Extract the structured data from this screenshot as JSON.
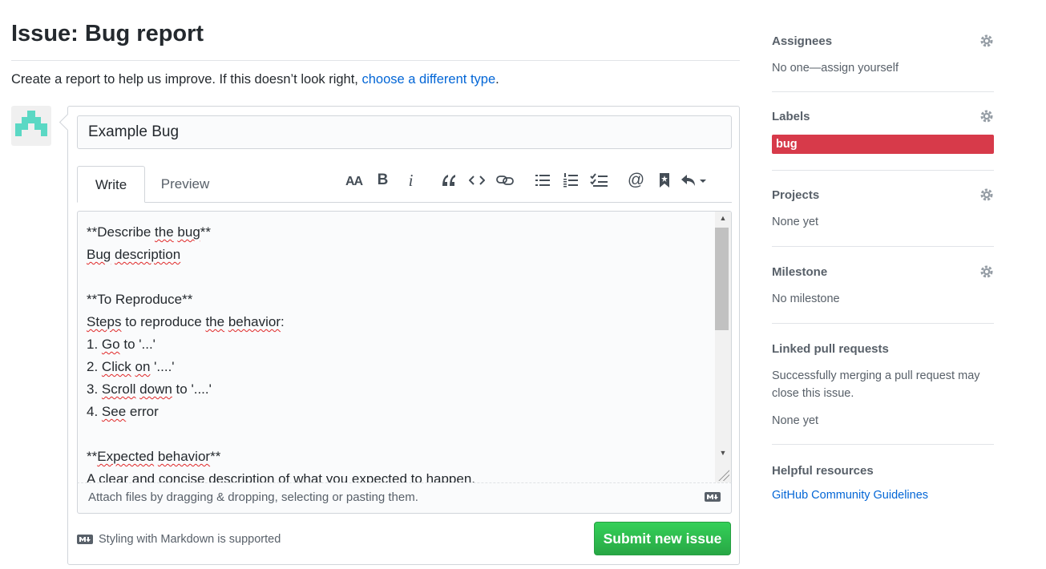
{
  "page": {
    "title": "Issue: Bug report",
    "intro_text": "Create a report to help us improve. If this doesn’t look right,",
    "intro_link": "choose a different type",
    "intro_end": "."
  },
  "form": {
    "title_value": "Example Bug",
    "tabs": {
      "write": "Write",
      "preview": "Preview"
    },
    "toolbar": {
      "heading": "AA",
      "bold": "B",
      "italic": "i",
      "quote": "❝",
      "code": "<>",
      "mention": "@"
    },
    "body_lines": [
      "**Describe the bug**",
      "Bug description",
      "",
      "**To Reproduce**",
      "Steps to reproduce the behavior:",
      "1. Go to '...'",
      "2. Click on '....'",
      "3. Scroll down to '....'",
      "4. See error",
      "",
      "**Expected behavior**",
      "A clear and concise description of what you expected to happen."
    ],
    "attach_text": "Attach files by dragging & dropping, selecting or pasting them.",
    "markdown_note": "Styling with Markdown is supported",
    "submit_label": "Submit new issue"
  },
  "sidebar": {
    "assignees": {
      "heading": "Assignees",
      "value": "No one—assign yourself"
    },
    "labels": {
      "heading": "Labels",
      "items": [
        "bug"
      ],
      "label_color": "#d73a4a"
    },
    "projects": {
      "heading": "Projects",
      "value": "None yet"
    },
    "milestone": {
      "heading": "Milestone",
      "value": "No milestone"
    },
    "linked_prs": {
      "heading": "Linked pull requests",
      "description": "Successfully merging a pull request may close this issue.",
      "value": "None yet"
    },
    "helpful": {
      "heading": "Helpful resources",
      "link": "GitHub Community Guidelines"
    }
  },
  "colors": {
    "link": "#0366d6",
    "submit_green": "#28a745",
    "label_red": "#d73a4a",
    "avatar_teal": "#5bd8c4"
  }
}
